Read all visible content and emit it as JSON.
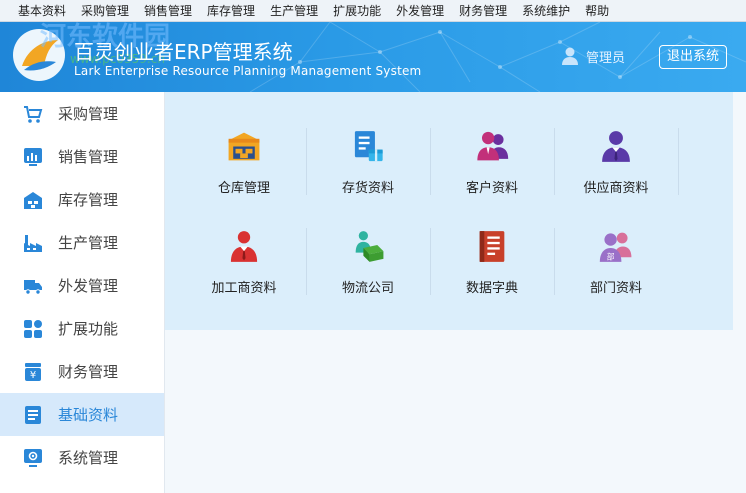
{
  "menu": [
    "基本资料",
    "采购管理",
    "销售管理",
    "库存管理",
    "生产管理",
    "扩展功能",
    "外发管理",
    "财务管理",
    "系统维护",
    "帮助"
  ],
  "header": {
    "title_cn": "百灵创业者ERP管理系统",
    "title_en": "Lark Enterprise Resource Planning Management System",
    "watermark": "河东软件园",
    "watermark_url": "www.pc0359.cn",
    "user": "管理员",
    "logout": "退出系统"
  },
  "sidebar": {
    "active_index": 7,
    "items": [
      {
        "label": "采购管理",
        "icon": "cart-icon"
      },
      {
        "label": "销售管理",
        "icon": "sales-chart-icon"
      },
      {
        "label": "库存管理",
        "icon": "warehouse-icon"
      },
      {
        "label": "生产管理",
        "icon": "factory-icon"
      },
      {
        "label": "外发管理",
        "icon": "truck-icon"
      },
      {
        "label": "扩展功能",
        "icon": "grid-icon"
      },
      {
        "label": "财务管理",
        "icon": "yuan-icon"
      },
      {
        "label": "基础资料",
        "icon": "document-icon"
      },
      {
        "label": "系统管理",
        "icon": "monitor-gear-icon"
      }
    ]
  },
  "tiles": [
    {
      "label": "仓库管理",
      "icon": "warehouse-icon"
    },
    {
      "label": "存货资料",
      "icon": "inventory-doc-icon"
    },
    {
      "label": "客户资料",
      "icon": "customers-icon"
    },
    {
      "label": "供应商资料",
      "icon": "supplier-icon"
    },
    {
      "label": "加工商资料",
      "icon": "processor-icon"
    },
    {
      "label": "物流公司",
      "icon": "logistics-icon"
    },
    {
      "label": "数据字典",
      "icon": "dictionary-icon"
    },
    {
      "label": "部门资料",
      "icon": "department-icon"
    }
  ],
  "department_icon_text": "部",
  "colors": {
    "header": "#2a9ae6",
    "active": "#d6e9fb",
    "panel": "#dbeefb",
    "accent": "#2a87d8"
  }
}
